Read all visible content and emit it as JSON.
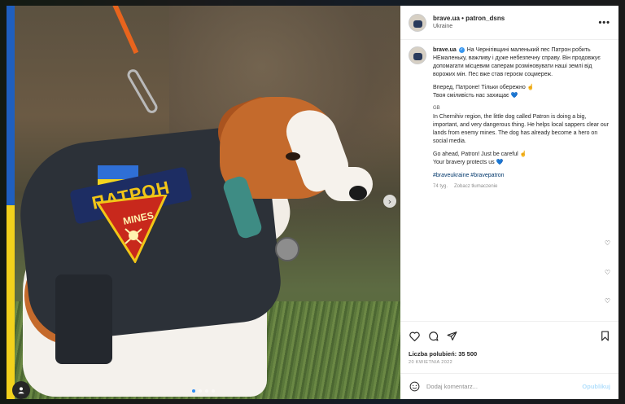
{
  "header": {
    "username": "brave.ua",
    "separator": " • ",
    "coauthor": "patron_dsns",
    "location": "Ukraine",
    "more_icon": "more-horizontal-icon"
  },
  "photo": {
    "patch_label": "ПАТРОН",
    "mines_label": "MINES",
    "user_tag_icon": "user-icon",
    "next_icon": "chevron-right-icon",
    "slide_count": 4,
    "active_slide": 1
  },
  "caption": {
    "username": "brave.ua",
    "ua_text": "На Чернігівщині маленький пес Патрон робить НЕмаленьку, важливу і дуже небезпечну справу. Він продовжує допомагати місцевим саперам розміновувати наші землі від ворожих мін. Пес вже став героєм соцмереж.",
    "ua_cheer_1": "Вперед, Патроне! Тільки обережно ☝",
    "ua_cheer_2": "Твоя сміливість нас захищає 💙",
    "lang_marker": "GB",
    "en_text": "In Chernihiv region, the little dog called Patron is doing a big, important, and very dangerous thing. He helps local sappers clear our lands from enemy mines. The dog has already become a hero on social media.",
    "en_cheer_1": "Go ahead, Patron! Just be careful ☝",
    "en_cheer_2": "Your bravery protects us 💙",
    "hashtags": "#braveukraine #bravepatron",
    "age": "74 tyg.",
    "translate": "Zobacz tłumaczenie"
  },
  "actions": {
    "like_icon": "heart-icon",
    "comment_icon": "comment-icon",
    "share_icon": "send-icon",
    "save_icon": "bookmark-icon"
  },
  "likes_text": "Liczba polubień: 35 500",
  "date_text": "20 KWIETNIA 2022",
  "comment": {
    "emoji_icon": "emoji-icon",
    "placeholder": "Dodaj komentarz...",
    "post_label": "Opublikuj"
  },
  "colors": {
    "link": "#00376b",
    "verified": "#3897f0",
    "flag_blue": "#1f5fbf",
    "flag_yellow": "#f2d21c"
  }
}
